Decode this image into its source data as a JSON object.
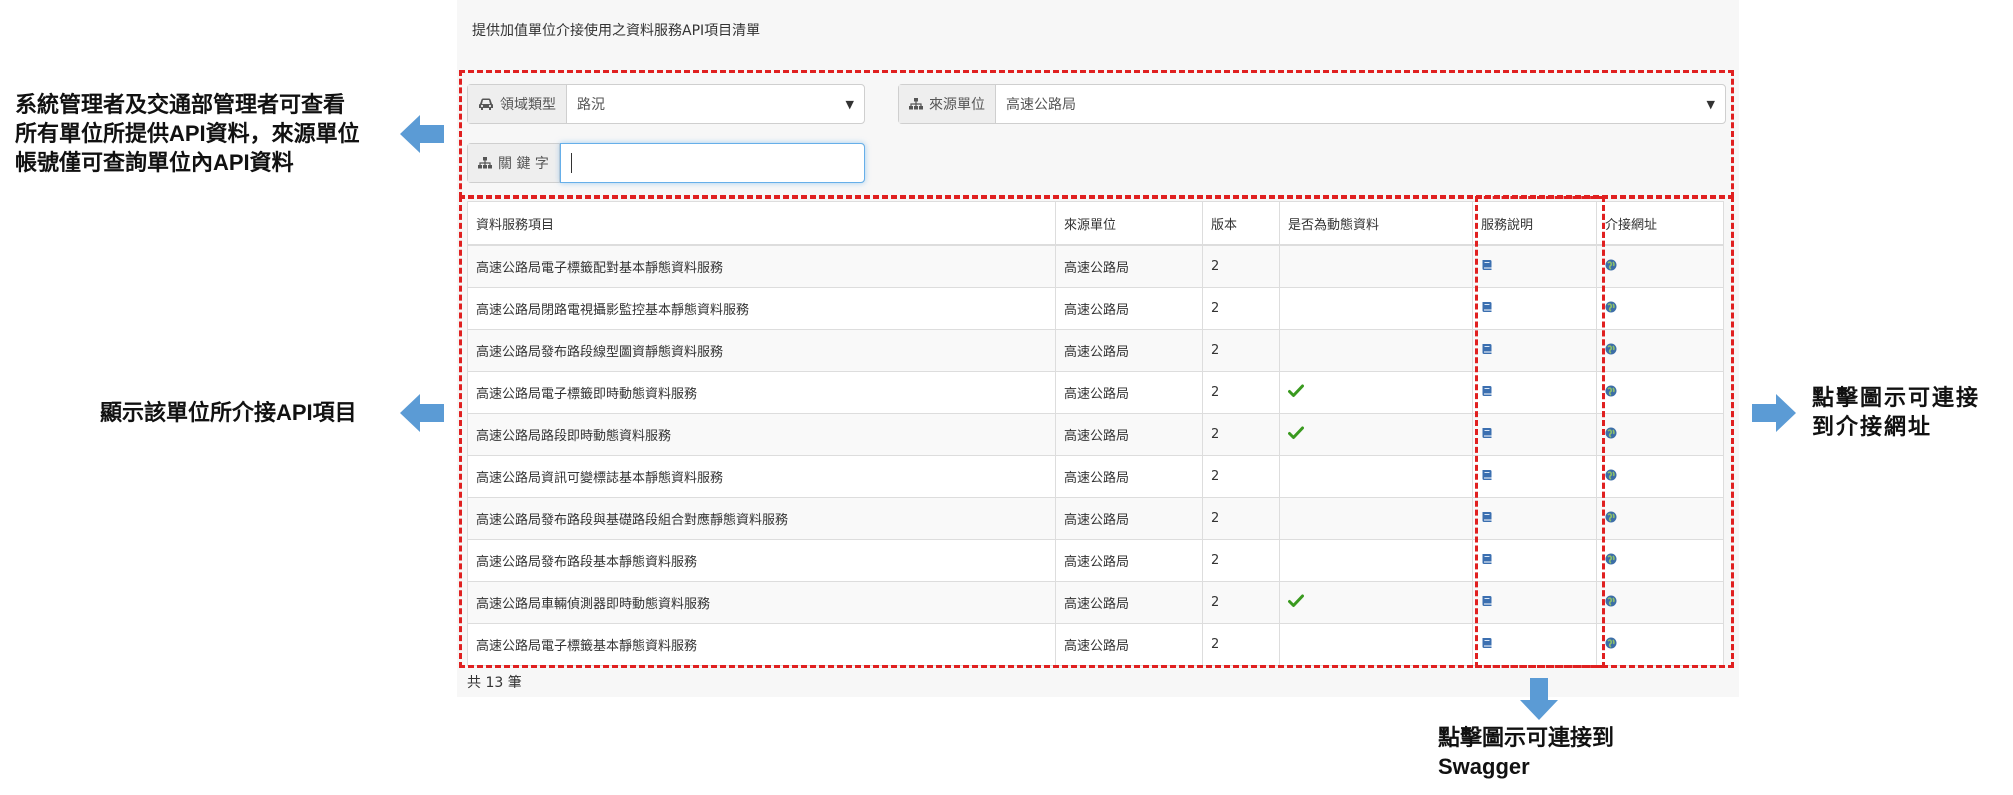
{
  "panel": {
    "title": "提供加值單位介接使用之資料服務API項目清單"
  },
  "filters": {
    "domain_label": "領域類型",
    "domain_value": "路況",
    "source_label": "來源單位",
    "source_value": "高速公路局",
    "keyword_label": "關 鍵 字",
    "keyword_value": ""
  },
  "table": {
    "headers": [
      "資料服務項目",
      "來源單位",
      "版本",
      "是否為動態資料",
      "服務說明",
      "介接網址"
    ],
    "rows": [
      {
        "name": "高速公路局電子標籤配對基本靜態資料服務",
        "source": "高速公路局",
        "version": "2",
        "dynamic": false
      },
      {
        "name": "高速公路局閉路電視攝影監控基本靜態資料服務",
        "source": "高速公路局",
        "version": "2",
        "dynamic": false
      },
      {
        "name": "高速公路局發布路段線型圖資靜態資料服務",
        "source": "高速公路局",
        "version": "2",
        "dynamic": false
      },
      {
        "name": "高速公路局電子標籤即時動態資料服務",
        "source": "高速公路局",
        "version": "2",
        "dynamic": true
      },
      {
        "name": "高速公路局路段即時動態資料服務",
        "source": "高速公路局",
        "version": "2",
        "dynamic": true
      },
      {
        "name": "高速公路局資訊可變標誌基本靜態資料服務",
        "source": "高速公路局",
        "version": "2",
        "dynamic": false
      },
      {
        "name": "高速公路局發布路段與基礎路段組合對應靜態資料服務",
        "source": "高速公路局",
        "version": "2",
        "dynamic": false
      },
      {
        "name": "高速公路局發布路段基本靜態資料服務",
        "source": "高速公路局",
        "version": "2",
        "dynamic": false
      },
      {
        "name": "高速公路局車輛偵測器即時動態資料服務",
        "source": "高速公路局",
        "version": "2",
        "dynamic": true
      },
      {
        "name": "高速公路局電子標籤基本靜態資料服務",
        "source": "高速公路局",
        "version": "2",
        "dynamic": false
      }
    ],
    "total_text": "共 13 筆"
  },
  "annotations": {
    "left_top": [
      "系統管理者及交通部管理者可查看",
      "所有單位所提供API資料，來源單位",
      "帳號僅可查詢單位內API資料"
    ],
    "left_mid": "顯示該單位所介接API項目",
    "right": [
      "點擊圖示可連接",
      "到介接網址"
    ],
    "bottom": [
      "點擊圖示可連接到",
      "Swagger"
    ]
  },
  "colors": {
    "dashed_box": "#e02020",
    "arrow": "#5b9bd5",
    "check": "#3a9a1f"
  },
  "icons": {
    "domain": "car-icon",
    "source": "sitemap-icon",
    "keyword": "sitemap-icon",
    "doc": "book-icon",
    "link": "globe-icon",
    "dynamic": "check-icon"
  }
}
